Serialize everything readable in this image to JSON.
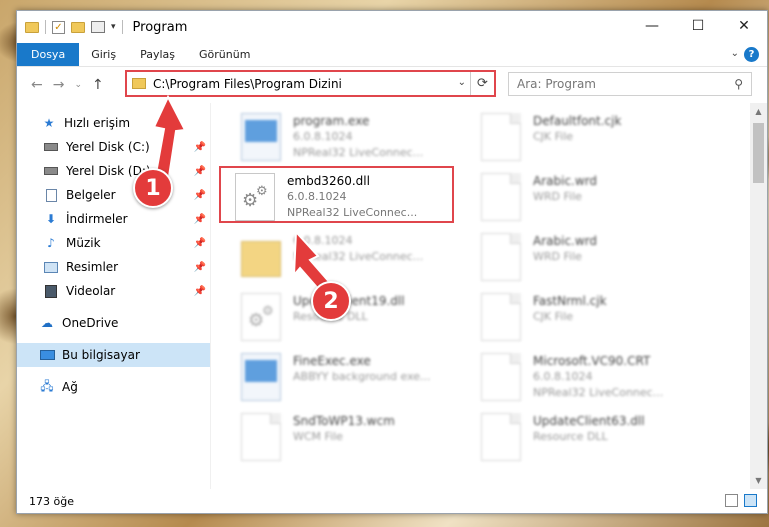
{
  "window": {
    "title": "Program",
    "controls": {
      "minimize": "—",
      "maximize": "☐",
      "close": "✕"
    }
  },
  "ribbon": {
    "tabs": [
      {
        "label": "Dosya",
        "active": true
      },
      {
        "label": "Giriş"
      },
      {
        "label": "Paylaş"
      },
      {
        "label": "Görünüm"
      }
    ],
    "help_label": "?"
  },
  "address": {
    "path": "C:\\Program Files\\Program Dizini",
    "refresh_icon": "⟳"
  },
  "search": {
    "placeholder": "Ara: Program",
    "icon": "⚲"
  },
  "sidebar": {
    "quick_access": "Hızlı erişim",
    "items": [
      {
        "label": "Yerel Disk (C:)",
        "icon": "drive-icon"
      },
      {
        "label": "Yerel Disk (D:)",
        "icon": "drive-icon"
      },
      {
        "label": "Belgeler",
        "icon": "documents-icon"
      },
      {
        "label": "İndirmeler",
        "icon": "downloads-icon"
      },
      {
        "label": "Müzik",
        "icon": "music-icon"
      },
      {
        "label": "Resimler",
        "icon": "pictures-icon"
      },
      {
        "label": "Videolar",
        "icon": "videos-icon"
      }
    ],
    "onedrive": "OneDrive",
    "this_pc": "Bu bilgisayar",
    "network": "Ağ"
  },
  "files": [
    {
      "name": "program.exe",
      "sub1": "6.0.8.1024",
      "sub2": "NPReal32 LiveConnec...",
      "icon": "exe"
    },
    {
      "name": "Defaultfont.cjk",
      "sub1": "CJK File",
      "sub2": "",
      "icon": "doc"
    },
    {
      "name": "embd3260.dll",
      "sub1": "6.0.8.1024",
      "sub2": "NPReal32 LiveConnec...",
      "icon": "dll",
      "highlighted": true
    },
    {
      "name": "Arabic.wrd",
      "sub1": "WRD File",
      "sub2": "",
      "icon": "doc"
    },
    {
      "name": "",
      "sub1": "6.0.8.1024",
      "sub2": "NPReal32 LiveConnec...",
      "icon": "folder"
    },
    {
      "name": "Arabic.wrd",
      "sub1": "WRD File",
      "sub2": "",
      "icon": "doc"
    },
    {
      "name": "UpdateClient19.dll",
      "sub1": "Resource DLL",
      "sub2": "",
      "icon": "dll"
    },
    {
      "name": "FastNrml.cjk",
      "sub1": "CJK File",
      "sub2": "",
      "icon": "doc"
    },
    {
      "name": "FineExec.exe",
      "sub1": "ABBYY background exe...",
      "sub2": "",
      "icon": "exe"
    },
    {
      "name": "Microsoft.VC90.CRT",
      "sub1": "6.0.8.1024",
      "sub2": "NPReal32 LiveConnec...",
      "icon": "doc"
    },
    {
      "name": "SndToWP13.wcm",
      "sub1": "WCM File",
      "sub2": "",
      "icon": "doc"
    },
    {
      "name": "UpdateClient63.dll",
      "sub1": "Resource DLL",
      "sub2": "",
      "icon": "doc"
    }
  ],
  "status": {
    "count": "173 öğe"
  },
  "callouts": {
    "one": "1",
    "two": "2"
  },
  "colors": {
    "accent": "#1979ca",
    "highlight": "#e0464c",
    "badge": "#e33b3b"
  }
}
